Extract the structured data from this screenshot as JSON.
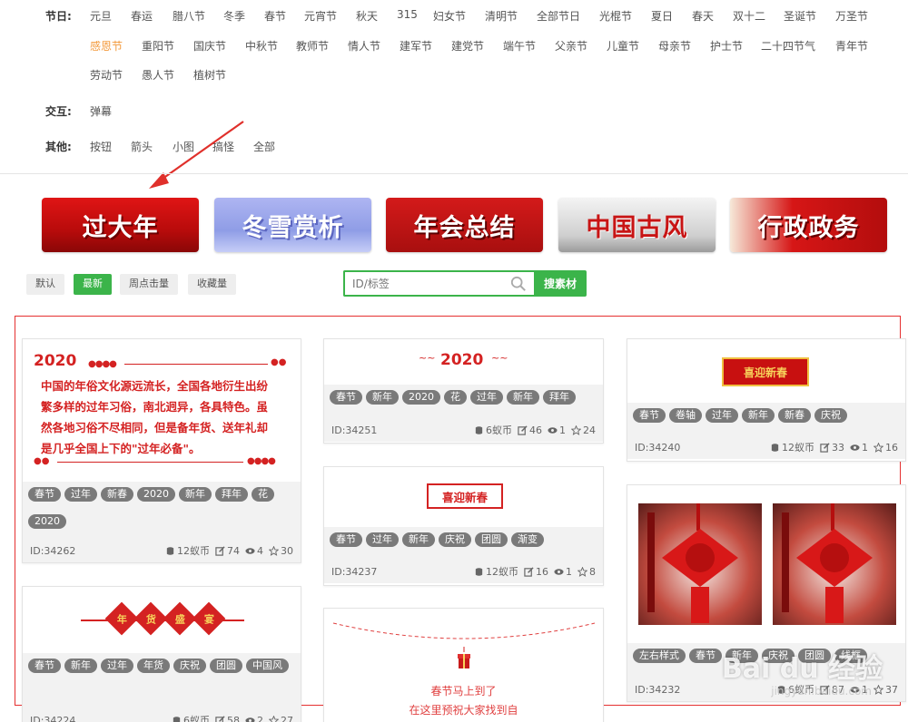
{
  "filters": {
    "festival_label": "节日:",
    "festival_row1": [
      "元旦",
      "春运",
      "腊八节",
      "冬季",
      "春节",
      "元宵节",
      "秋天",
      "315",
      "妇女节",
      "清明节",
      "全部节日",
      "光棍节",
      "夏日",
      "春天",
      "双十二",
      "圣诞节",
      "万圣节"
    ],
    "festival_row2": [
      "感恩节",
      "重阳节",
      "国庆节",
      "中秋节",
      "教师节",
      "情人节",
      "建军节",
      "建党节",
      "端午节",
      "父亲节",
      "儿童节",
      "母亲节",
      "护士节",
      "二十四节气",
      "青年节"
    ],
    "festival_row3": [
      "劳动节",
      "愚人节",
      "植树节"
    ],
    "interaction_label": "交互:",
    "interaction_items": [
      "弹幕"
    ],
    "other_label": "其他:",
    "other_items": [
      "按钮",
      "箭头",
      "小图",
      "搞怪",
      "全部"
    ]
  },
  "banners": [
    "过大年",
    "冬雪赏析",
    "年会总结",
    "中国古风",
    "行政政务"
  ],
  "sort": [
    "默认",
    "最新",
    "周点击量",
    "收藏量"
  ],
  "search": {
    "placeholder": "ID/标签",
    "button": "搜素材"
  },
  "cards": {
    "c1": {
      "year": "2020",
      "lines": [
        "中国的年俗文化源远流长，全国各地衍生出纷",
        "繁多样的过年习俗，南北迥异，各具特色。虽",
        "然各地习俗不尽相同，但是备年货、送年礼却",
        "是几乎全国上下的\"过年必备\"。"
      ],
      "tags": [
        "春节",
        "过年",
        "新春",
        "2020",
        "新年",
        "拜年",
        "花",
        "2020"
      ],
      "id": "ID:34262",
      "coin": "12蚁币",
      "edit": "74",
      "view": "4",
      "star": "30"
    },
    "c2": {
      "chars": [
        "年",
        "货",
        "盛",
        "宴"
      ],
      "tags": [
        "春节",
        "新年",
        "过年",
        "年货",
        "庆祝",
        "团圆",
        "中国风"
      ],
      "id": "ID:34224",
      "coin": "6蚁币",
      "edit": "58",
      "view": "2",
      "star": "27"
    },
    "c3": {
      "year": "2020",
      "tags": [
        "春节",
        "新年",
        "2020",
        "花",
        "过年",
        "新年",
        "拜年"
      ],
      "id": "ID:34251",
      "coin": "6蚁币",
      "edit": "46",
      "view": "1",
      "star": "24"
    },
    "c4": {
      "title": "喜迎新春",
      "tags": [
        "春节",
        "过年",
        "新年",
        "庆祝",
        "团圆",
        "渐变"
      ],
      "id": "ID:34237",
      "coin": "12蚁币",
      "edit": "16",
      "view": "1",
      "star": "8"
    },
    "c5": {
      "line1": "春节马上到了",
      "line2": "在这里预祝大家找到自"
    },
    "c6": {
      "title": "喜迎新春",
      "tags": [
        "春节",
        "卷轴",
        "过年",
        "新年",
        "新春",
        "庆祝"
      ],
      "id": "ID:34240",
      "coin": "12蚁币",
      "edit": "33",
      "view": "1",
      "star": "16"
    },
    "c7": {
      "tags": [
        "左右样式",
        "春节",
        "新年",
        "庆祝",
        "团圆",
        "线框"
      ],
      "id": "ID:34232",
      "coin": "6蚁币",
      "edit": "87",
      "view": "1",
      "star": "37"
    }
  },
  "watermark": {
    "brand": "Bai du 经验",
    "url": "jingyan.baidu.com"
  },
  "colors": {
    "accent": "#3bb44a",
    "active_tag": "#f39a3c",
    "highlight": "#e53030"
  }
}
